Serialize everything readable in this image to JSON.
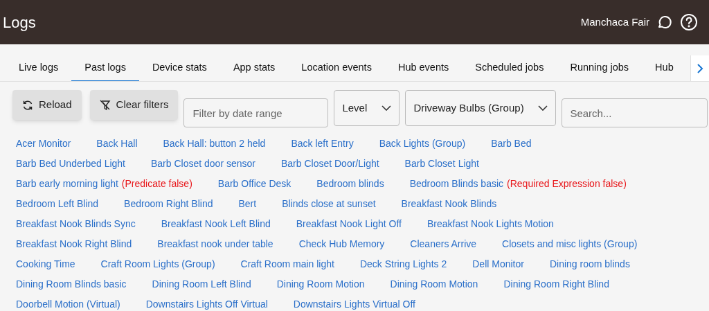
{
  "header": {
    "title": "Logs",
    "hub_name": "Manchaca Fair"
  },
  "tabs": [
    {
      "label": "Live logs",
      "selected": false
    },
    {
      "label": "Past logs",
      "selected": true
    },
    {
      "label": "Device stats",
      "selected": false
    },
    {
      "label": "App stats",
      "selected": false
    },
    {
      "label": "Location events",
      "selected": false
    },
    {
      "label": "Hub events",
      "selected": false
    },
    {
      "label": "Scheduled jobs",
      "selected": false
    },
    {
      "label": "Running jobs",
      "selected": false
    },
    {
      "label": "Hub",
      "selected": false
    }
  ],
  "toolbar": {
    "reload": "Reload",
    "clear_filters": "Clear filters",
    "date_filter": {
      "placeholder": "Filter by date range"
    },
    "level": {
      "value": "Level"
    },
    "source": {
      "value": "Driveway Bulbs (Group)"
    },
    "search": {
      "placeholder": "Search..."
    }
  },
  "sources": [
    [
      {
        "name": "Acer Monitor"
      },
      {
        "name": "Back Hall"
      },
      {
        "name": "Back Hall: button 2 held"
      },
      {
        "name": "Back left Entry"
      },
      {
        "name": "Back Lights (Group)"
      },
      {
        "name": "Barb Bed"
      }
    ],
    [
      {
        "name": "Barb Bed Underbed Light"
      },
      {
        "name": "Barb Closet door sensor"
      },
      {
        "name": "Barb Closet Door/Light"
      },
      {
        "name": "Barb Closet Light"
      }
    ],
    [
      {
        "name": "Barb early morning light",
        "note": "(Predicate false)"
      },
      {
        "name": "Barb Office Desk"
      },
      {
        "name": "Bedroom blinds"
      },
      {
        "name": "Bedroom Blinds basic",
        "note": "(Required Expression false)"
      }
    ],
    [
      {
        "name": "Bedroom Left Blind"
      },
      {
        "name": "Bedroom Right Blind"
      },
      {
        "name": "Bert"
      },
      {
        "name": "Blinds close at sunset"
      },
      {
        "name": "Breakfast Nook Blinds"
      }
    ],
    [
      {
        "name": "Breakfast Nook Blinds Sync"
      },
      {
        "name": "Breakfast Nook Left Blind"
      },
      {
        "name": "Breakfast Nook Light Off"
      },
      {
        "name": "Breakfast Nook Lights Motion"
      }
    ],
    [
      {
        "name": "Breakfast Nook Right Blind"
      },
      {
        "name": "Breakfast nook under table"
      },
      {
        "name": "Check Hub Memory"
      },
      {
        "name": "Cleaners Arrive"
      },
      {
        "name": "Closets and misc lights (Group)"
      }
    ],
    [
      {
        "name": "Cooking Time"
      },
      {
        "name": "Craft Room Lights (Group)"
      },
      {
        "name": "Craft Room main light"
      },
      {
        "name": "Deck String Lights 2"
      },
      {
        "name": "Dell Monitor"
      },
      {
        "name": "Dining room blinds"
      }
    ],
    [
      {
        "name": "Dining Room Blinds basic"
      },
      {
        "name": "Dining Room Left Blind"
      },
      {
        "name": "Dining Room Motion"
      },
      {
        "name": "Dining Room Motion"
      },
      {
        "name": "Dining Room Right Blind"
      }
    ],
    [
      {
        "name": "Doorbell Motion (Virtual)"
      },
      {
        "name": "Downstairs Lights Off Virtual"
      },
      {
        "name": "Downstairs Lights Virtual Off"
      }
    ]
  ]
}
